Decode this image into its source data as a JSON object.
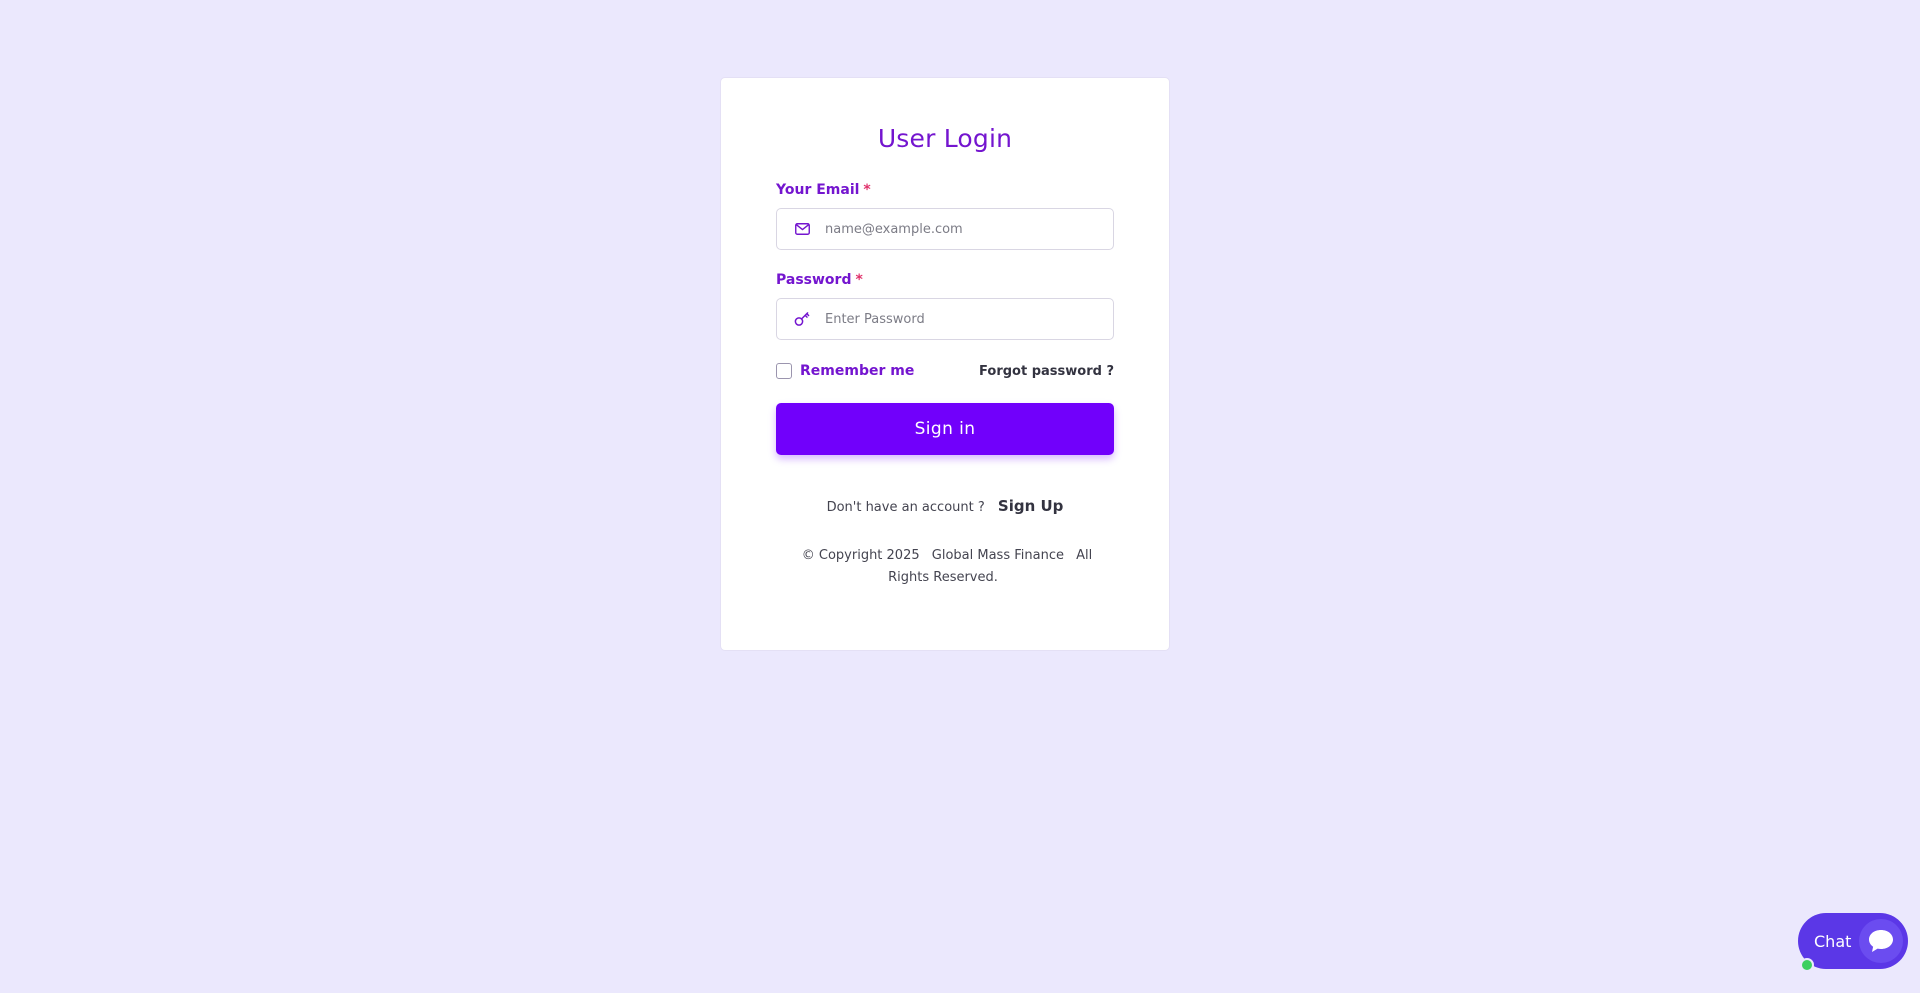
{
  "login": {
    "title": "User Login",
    "email": {
      "label": "Your Email",
      "required_mark": "*",
      "placeholder": "name@example.com",
      "value": "",
      "icon": "mail-icon"
    },
    "password": {
      "label": "Password",
      "required_mark": "*",
      "placeholder": "Enter Password",
      "value": "",
      "icon": "key-icon"
    },
    "remember_label": "Remember me",
    "forgot_label": "Forgot password ?",
    "signin_label": "Sign in",
    "signup_prompt": "Don't have an account ?",
    "signup_label": "Sign Up"
  },
  "footer": {
    "copyright": "© Copyright 2025",
    "company": "Global Mass Finance",
    "rights": "All Rights Reserved."
  },
  "chat": {
    "label": "Chat",
    "icon": "chat-bubble-icon"
  },
  "colors": {
    "background": "#ebe8fd",
    "accent": "#7415cf",
    "button": "#7100fb",
    "chat": "#5b37e7",
    "online": "#3ccf5f",
    "required": "#e0306a"
  }
}
